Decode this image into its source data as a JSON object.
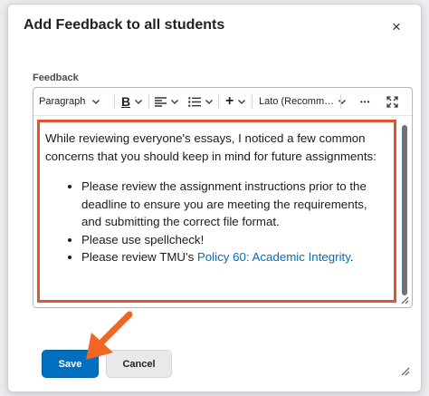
{
  "dialog": {
    "title": "Add Feedback to all students",
    "close_icon": "×"
  },
  "field": {
    "label": "Feedback"
  },
  "toolbar": {
    "paragraph": "Paragraph",
    "bold_icon": "B",
    "plus_icon": "+",
    "font": "Lato (Recomm…",
    "more_icon": "•••"
  },
  "content": {
    "intro": "While reviewing everyone's essays, I noticed a few common concerns that you should keep in mind for future assignments:",
    "bullets": [
      "Please review the assignment instructions prior to the deadline to ensure you are meeting the requirements, and submitting the correct file format.",
      "Please use spellcheck!"
    ],
    "bullet3_prefix": "Please review TMU's ",
    "bullet3_link": "Policy 60: Academic Integrity",
    "bullet3_suffix": "."
  },
  "buttons": {
    "save": "Save",
    "cancel": "Cancel"
  },
  "colors": {
    "primary": "#006fbf",
    "highlight": "#e2532f",
    "arrow": "#f26522"
  }
}
